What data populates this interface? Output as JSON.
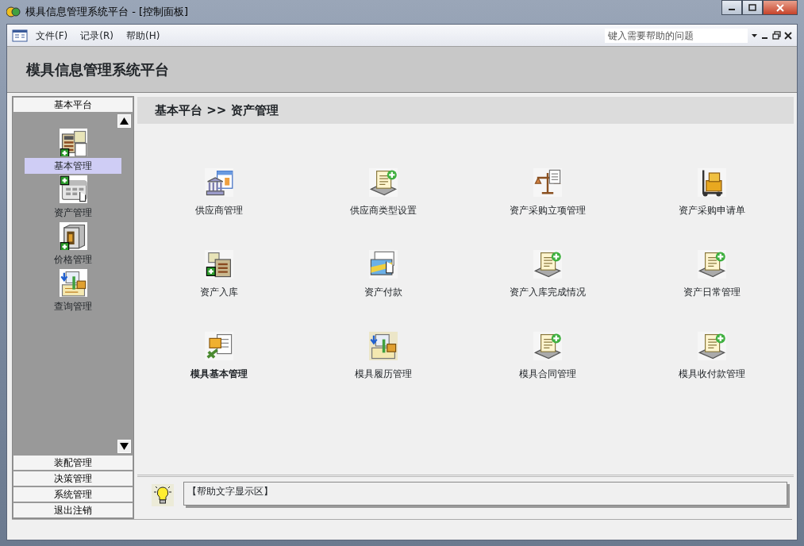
{
  "window": {
    "title": "模具信息管理系统平台 - [控制面板]"
  },
  "menu": [
    {
      "label": "文件(F)"
    },
    {
      "label": "记录(R)"
    },
    {
      "label": "帮助(H)"
    }
  ],
  "help_search": {
    "placeholder": "键入需要帮助的问题"
  },
  "header": {
    "title": "模具信息管理系统平台"
  },
  "sidebar": {
    "group": "基本平台",
    "items": [
      {
        "label": "基本管理",
        "selected": true
      },
      {
        "label": "资产管理",
        "selected": false
      },
      {
        "label": "价格管理",
        "selected": false
      },
      {
        "label": "查询管理",
        "selected": false
      }
    ],
    "other_groups": [
      "装配管理",
      "决策管理",
      "系统管理",
      "退出注销"
    ]
  },
  "breadcrumb": "基本平台 >> 资产管理",
  "tiles": [
    {
      "label": "供应商管理",
      "selected": false
    },
    {
      "label": "供应商类型设置",
      "selected": false
    },
    {
      "label": "资产采购立项管理",
      "selected": false
    },
    {
      "label": "资产采购申请单",
      "selected": false
    },
    {
      "label": "资产入库",
      "selected": false
    },
    {
      "label": "资产付款",
      "selected": false
    },
    {
      "label": "资产入库完成情况",
      "selected": false
    },
    {
      "label": "资产日常管理",
      "selected": false
    },
    {
      "label": "模具基本管理",
      "selected": true
    },
    {
      "label": "模具履历管理",
      "selected": false
    },
    {
      "label": "模具合同管理",
      "selected": false
    },
    {
      "label": "模具收付款管理",
      "selected": false
    }
  ],
  "help_text": "【帮助文字显示区】"
}
